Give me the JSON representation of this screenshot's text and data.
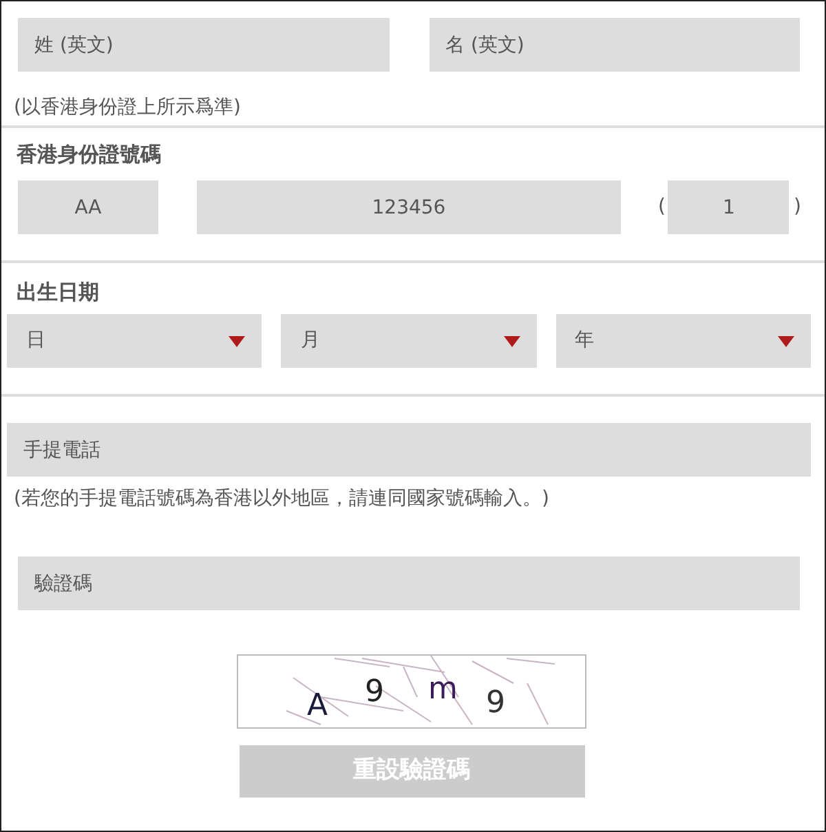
{
  "name_fields": [
    {
      "placeholder": "姓 (英文)"
    },
    {
      "placeholder": "名 (英文)"
    }
  ],
  "name_note": "(以香港身份證上所示爲準)",
  "hkid": {
    "label": "香港身份證號碼",
    "prefix": {
      "placeholder": "AA"
    },
    "number": {
      "placeholder": "123456"
    },
    "open_paren": "(",
    "check_digit": {
      "placeholder": "1"
    },
    "close_paren": ")"
  },
  "birth_date": {
    "label": "出生日期",
    "selects": [
      {
        "placeholder": "日"
      },
      {
        "placeholder": "月"
      },
      {
        "placeholder": "年"
      }
    ]
  },
  "mobile": {
    "placeholder": "手提電話",
    "note": "(若您的手提電話號碼為香港以外地區，請連同國家號碼輸入。)"
  },
  "captcha_field": {
    "placeholder": "驗證碼"
  },
  "captcha": {
    "characters": [
      "A",
      "9",
      "m",
      "9"
    ]
  },
  "reset_button": {
    "label": "重設驗證碼",
    "disabled": true
  }
}
